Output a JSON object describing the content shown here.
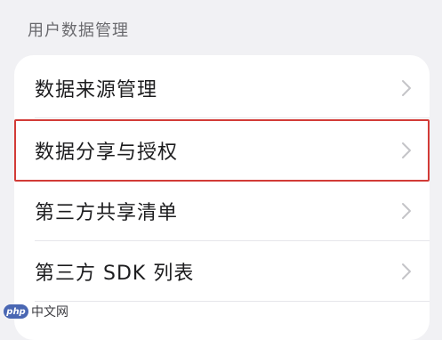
{
  "section": {
    "title": "用户数据管理"
  },
  "rows": [
    {
      "label": "数据来源管理"
    },
    {
      "label": "数据分享与授权"
    },
    {
      "label": "第三方共享清单"
    },
    {
      "label": "第三方 SDK 列表"
    }
  ],
  "watermark": {
    "logo": "php",
    "text": "中文网"
  },
  "colors": {
    "highlight_border": "#d23b37",
    "background": "#f1f1f4",
    "card": "#ffffff"
  },
  "icons": {
    "chevron": "chevron-right-icon"
  }
}
